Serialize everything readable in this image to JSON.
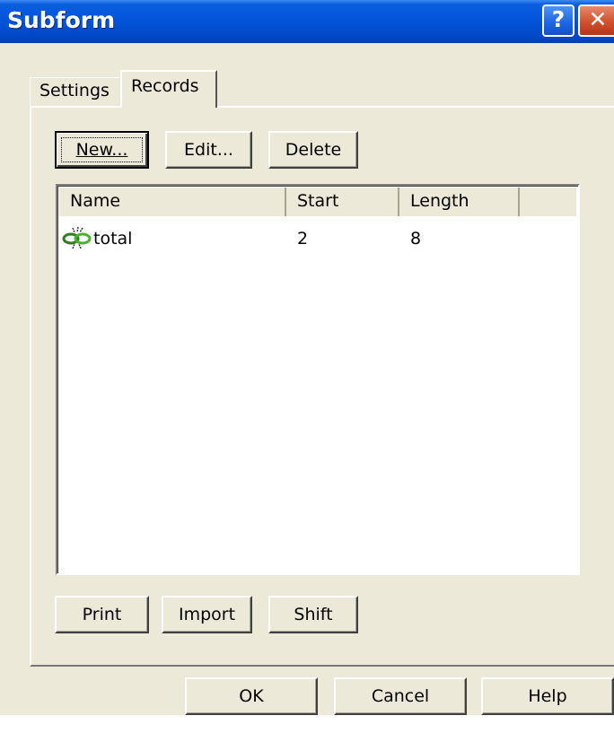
{
  "window": {
    "title": "Subform",
    "help_glyph": "?",
    "close_glyph": "✕"
  },
  "tabs": [
    {
      "label": "Settings",
      "active": false
    },
    {
      "label": "Records",
      "active": true
    }
  ],
  "toolbar": {
    "new_label": "New...",
    "edit_label": "Edit...",
    "delete_label": "Delete"
  },
  "table": {
    "columns": [
      "Name",
      "Start",
      "Length",
      ""
    ],
    "rows": [
      {
        "icon": "record-link-icon",
        "name": "total",
        "start": "2",
        "length": "8"
      }
    ]
  },
  "bottom_buttons": {
    "print_label": "Print",
    "import_label": "Import",
    "shift_label": "Shift"
  },
  "dialog_buttons": {
    "ok_label": "OK",
    "cancel_label": "Cancel",
    "help_label": "Help"
  },
  "colors": {
    "titlebar": "#0353d8",
    "dialog_bg": "#ece9d8",
    "close_button": "#d1502c"
  }
}
